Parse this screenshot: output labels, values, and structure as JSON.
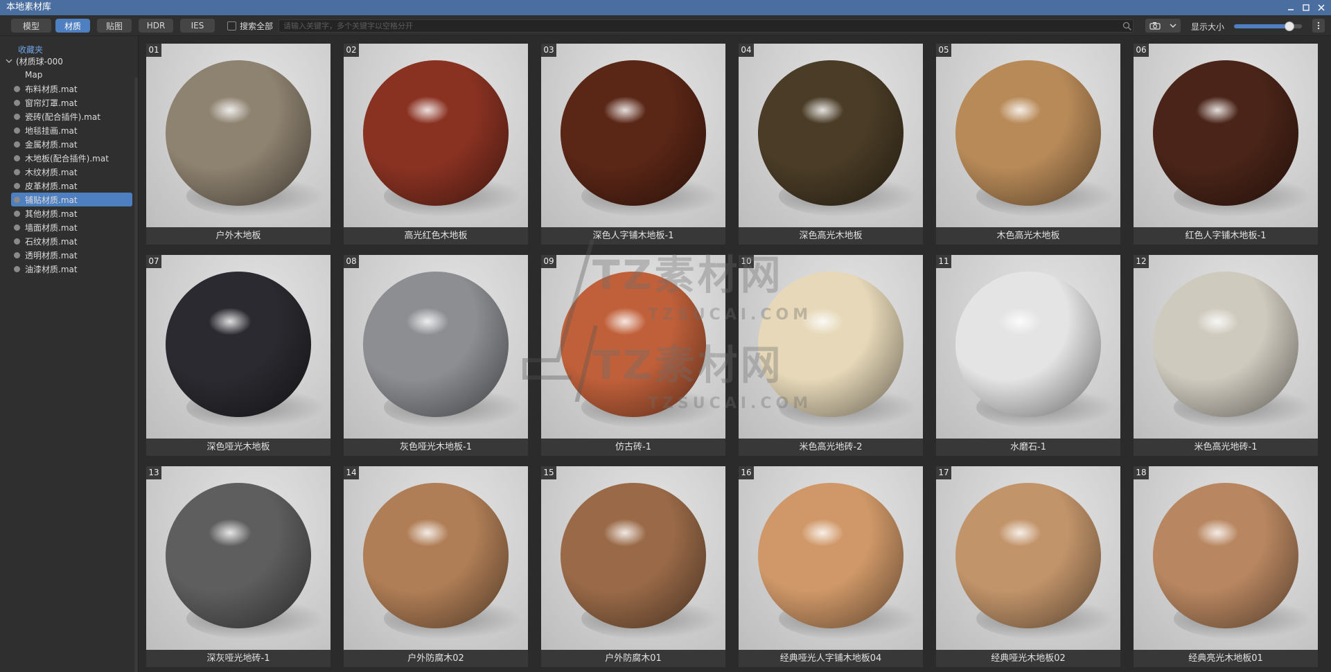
{
  "window": {
    "title": "本地素材库"
  },
  "toolbar": {
    "tabs": [
      "模型",
      "材质",
      "贴图",
      "HDR",
      "IES"
    ],
    "active_tab": "材质",
    "search_all_label": "搜索全部",
    "search_placeholder": "请输入关键字，多个关键字以空格分开",
    "display_size_label": "显示大小",
    "display_size_value": 0.82
  },
  "sidebar": {
    "favorites": "收藏夹",
    "root": "(材质球-000",
    "subfolder": "Map",
    "items": [
      "布料材质.mat",
      "窗帘灯罩.mat",
      "瓷砖(配合插件).mat",
      "地毯挂画.mat",
      "金属材质.mat",
      "木地板(配合插件).mat",
      "木纹材质.mat",
      "皮革材质.mat",
      "铺贴材质.mat",
      "其他材质.mat",
      "墙面材质.mat",
      "石纹材质.mat",
      "透明材质.mat",
      "油漆材质.mat"
    ],
    "active_item": "铺贴材质.mat"
  },
  "materials": [
    {
      "num": "01",
      "name": "户外木地板",
      "color": "#8e8270"
    },
    {
      "num": "02",
      "name": "高光红色木地板",
      "color": "#8a3222"
    },
    {
      "num": "03",
      "name": "深色人字铺木地板-1",
      "color": "#5a2616"
    },
    {
      "num": "04",
      "name": "深色高光木地板",
      "color": "#4a3c26"
    },
    {
      "num": "05",
      "name": "木色高光木地板",
      "color": "#b88a58"
    },
    {
      "num": "06",
      "name": "红色人字铺木地板-1",
      "color": "#4a2418"
    },
    {
      "num": "07",
      "name": "深色哑光木地板",
      "color": "#2a2a30"
    },
    {
      "num": "08",
      "name": "灰色哑光木地板-1",
      "color": "#8c8e92"
    },
    {
      "num": "09",
      "name": "仿古砖-1",
      "color": "#c0603a"
    },
    {
      "num": "10",
      "name": "米色高光地砖-2",
      "color": "#e6d8b8"
    },
    {
      "num": "11",
      "name": "水磨石-1",
      "color": "#e4e4e4"
    },
    {
      "num": "12",
      "name": "米色高光地砖-1",
      "color": "#cfcabe"
    },
    {
      "num": "13",
      "name": "深灰哑光地砖-1",
      "color": "#5e5e5e"
    },
    {
      "num": "14",
      "name": "户外防腐木02",
      "color": "#b07e56"
    },
    {
      "num": "15",
      "name": "户外防腐木01",
      "color": "#9a6a48"
    },
    {
      "num": "16",
      "name": "经典哑光人字铺木地板04",
      "color": "#d09868"
    },
    {
      "num": "17",
      "name": "经典哑光木地板02",
      "color": "#c2946a"
    },
    {
      "num": "18",
      "name": "经典亮光木地板01",
      "color": "#b88660"
    }
  ],
  "watermark": {
    "brand": "TZ素材网",
    "domain": "TZSUCAI.COM"
  }
}
